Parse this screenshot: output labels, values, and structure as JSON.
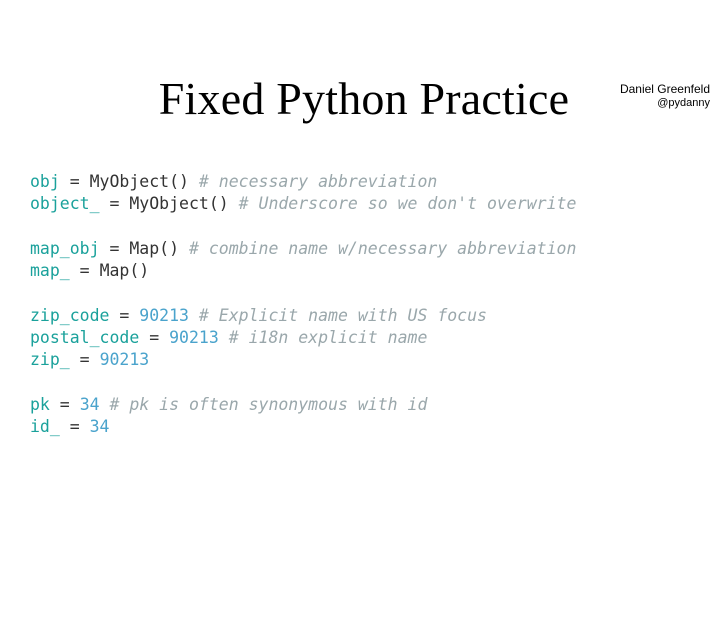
{
  "byline": {
    "author": "Daniel Greenfeld",
    "handle": "@pydanny"
  },
  "title": "Fixed Python Practice",
  "code": {
    "l1": {
      "var": "obj",
      "op": " = ",
      "call": "MyObject() ",
      "cm": "# necessary abbreviation"
    },
    "l2": {
      "var": "object_",
      "op": " = ",
      "call": "MyObject() ",
      "cm": "# Underscore so we don't overwrite"
    },
    "l3": {
      "blank": ""
    },
    "l4": {
      "var": "map_obj",
      "op": " = ",
      "call": "Map() ",
      "cm": "# combine name w/necessary abbreviation"
    },
    "l5": {
      "var": "map_",
      "op": " = ",
      "call": "Map()"
    },
    "l6": {
      "blank": ""
    },
    "l7": {
      "var": "zip_code",
      "op": " = ",
      "num": "90213",
      "sp": " ",
      "cm": "# Explicit name with US focus"
    },
    "l8": {
      "var": "postal_code",
      "op": " = ",
      "num": "90213",
      "sp": " ",
      "cm": "# i18n explicit name"
    },
    "l9": {
      "var": "zip_",
      "op": " = ",
      "num": "90213"
    },
    "l10": {
      "blank": ""
    },
    "l11": {
      "var": "pk",
      "op": " = ",
      "num": "34",
      "sp": " ",
      "cm": "# pk is often synonymous with id"
    },
    "l12": {
      "var": "id_",
      "op": " = ",
      "num": "34"
    }
  }
}
